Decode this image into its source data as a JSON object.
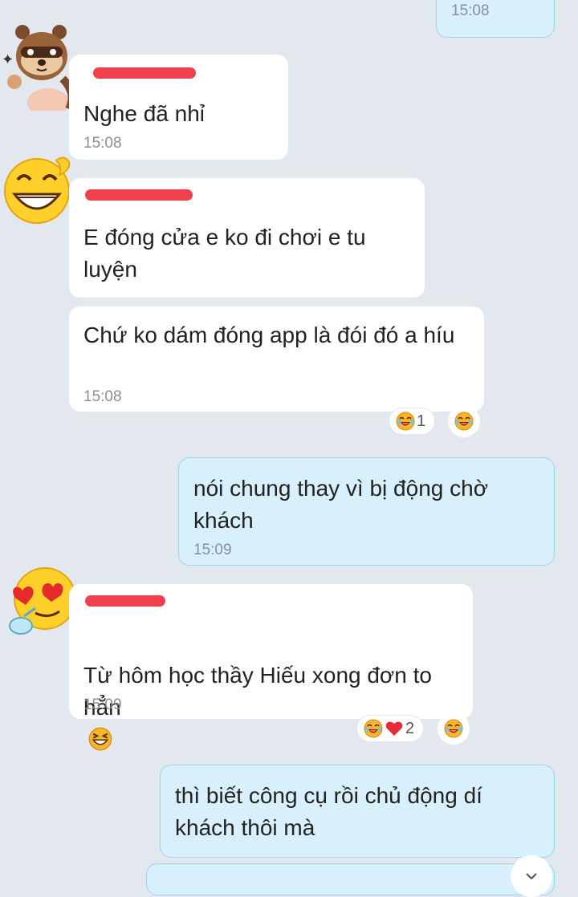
{
  "messages": [
    {
      "id": "m0",
      "time": "15:08"
    },
    {
      "id": "m1",
      "text": "Nghe đã nhỉ",
      "time": "15:08"
    },
    {
      "id": "m2",
      "text": "E đóng cửa e ko đi chơi e tu luyện"
    },
    {
      "id": "m3",
      "text": "Chứ ko dám đóng app là đói đó a híu",
      "time": "15:08",
      "reaction_count": "1"
    },
    {
      "id": "m4",
      "text": "nói chung thay vì bị động chờ khách",
      "time": "15:09"
    },
    {
      "id": "m5",
      "text": "Từ hôm học thầy Hiếu xong đơn to hẳn",
      "time": "15:09",
      "reaction_count": "2"
    },
    {
      "id": "m6",
      "text": "thì biết công cụ rồi chủ động dí khách thôi mà"
    }
  ],
  "icons": {
    "avatar1": "raccoon-sticker-avatar",
    "avatar2": "laughing-emoji-avatar",
    "avatar3": "heart-eyes-emoji-avatar",
    "reaction": "laughing-crying-emoji",
    "heart": "red-heart",
    "inline": "grinning-squint-emoji"
  },
  "colors": {
    "background": "#e3e7ee",
    "incoming_bubble": "#ffffff",
    "outgoing_bubble": "#d7f0fb",
    "redaction": "#ef2f3e"
  }
}
